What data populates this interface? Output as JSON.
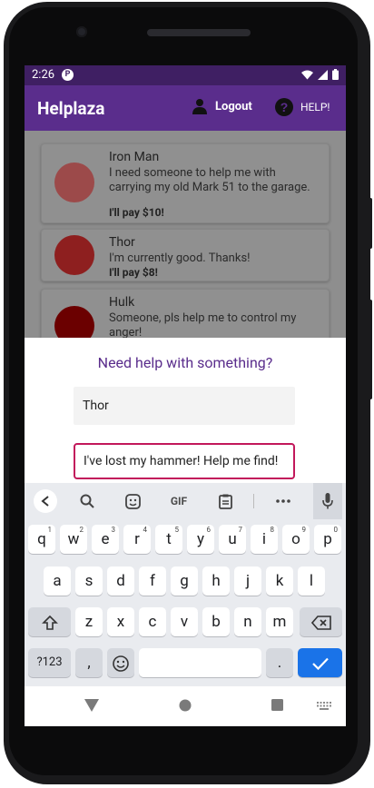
{
  "status_bar": {
    "time": "2:26",
    "app_badge": "P"
  },
  "app_bar": {
    "title": "Helplaza",
    "logout_label": "Logout",
    "help_label": "HELP!"
  },
  "requests": [
    {
      "name": "Iron Man",
      "message": "I need someone to help me with carrying my old Mark 51 to the garage.",
      "pay": "I'll pay $10!",
      "avatar_color": "#9c4a4a"
    },
    {
      "name": "Thor",
      "message": "I'm currently good. Thanks!",
      "pay": "I'll pay $8!",
      "avatar_color": "#8e1f1f"
    },
    {
      "name": "Hulk",
      "message": "Someone, pls help me to control my anger!",
      "pay": "",
      "avatar_color": "#6b0000"
    }
  ],
  "sheet": {
    "heading": "Need help with something?",
    "name_value": "Thor",
    "request_value": "I've lost my hammer! Help me find!"
  },
  "keyboard": {
    "toolbar": [
      "back-arrow",
      "search-icon",
      "sticker-icon",
      "GIF",
      "clipboard-icon",
      "more-icon",
      "mic-icon"
    ],
    "gif_label": "GIF",
    "row1": [
      {
        "k": "q",
        "h": "1"
      },
      {
        "k": "w",
        "h": "2"
      },
      {
        "k": "e",
        "h": "3"
      },
      {
        "k": "r",
        "h": "4"
      },
      {
        "k": "t",
        "h": "5"
      },
      {
        "k": "y",
        "h": "6"
      },
      {
        "k": "u",
        "h": "7"
      },
      {
        "k": "i",
        "h": "8"
      },
      {
        "k": "o",
        "h": "9"
      },
      {
        "k": "p",
        "h": "0"
      }
    ],
    "row2": [
      "a",
      "s",
      "d",
      "f",
      "g",
      "h",
      "j",
      "k",
      "l"
    ],
    "row3": [
      "z",
      "x",
      "c",
      "v",
      "b",
      "n",
      "m"
    ],
    "num_key": "?123",
    "comma_key": ",",
    "period_key": "."
  },
  "colors": {
    "primary": "#5a2d8c",
    "primary_dark": "#3f1f63",
    "accent_border": "#c2185b",
    "keyboard_action": "#1a73e8"
  }
}
